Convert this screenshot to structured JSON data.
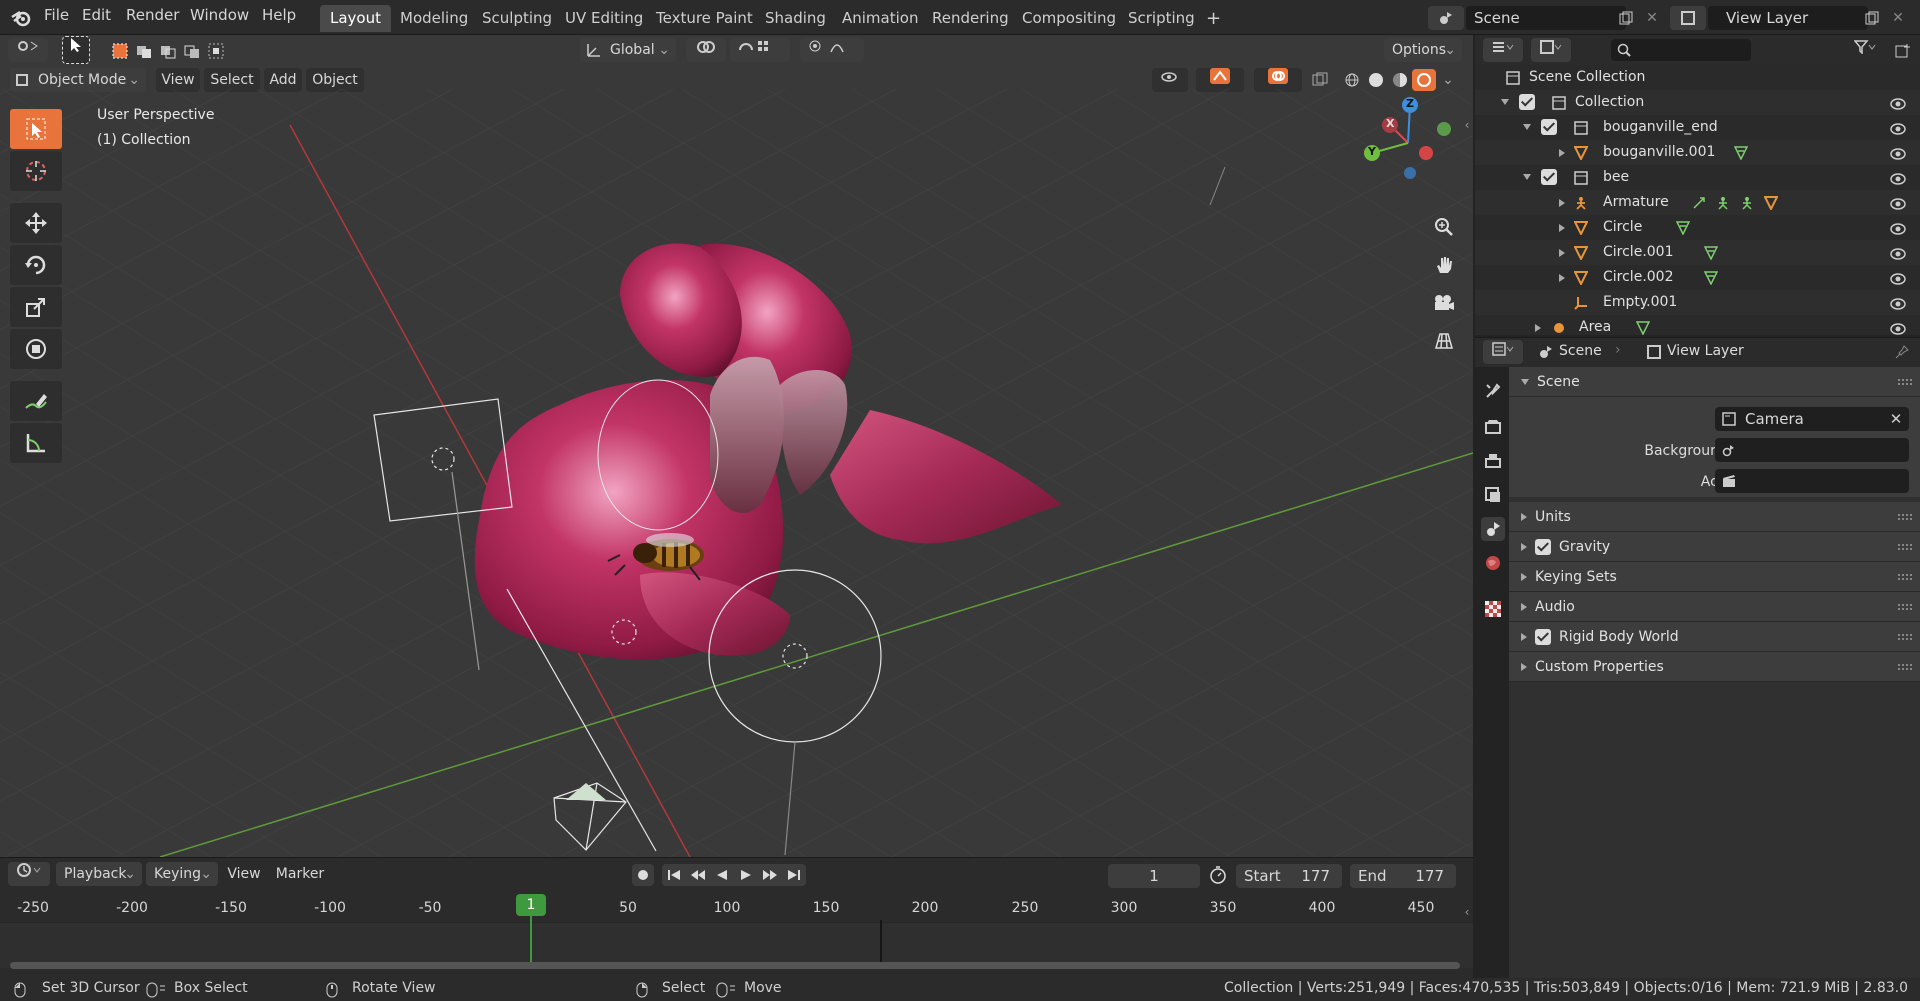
{
  "menus": [
    "File",
    "Edit",
    "Render",
    "Window",
    "Help"
  ],
  "workspaces": [
    "Layout",
    "Modeling",
    "Sculpting",
    "UV Editing",
    "Texture Paint",
    "Shading",
    "Animation",
    "Rendering",
    "Compositing",
    "Scripting"
  ],
  "scene_field": "Scene",
  "view_layer_field": "View Layer",
  "toolbar": {
    "orientation": "Global",
    "options": "Options"
  },
  "viewport": {
    "mode": "Object Mode",
    "menus": [
      "View",
      "Select",
      "Add",
      "Object"
    ],
    "overlay_title": "User Perspective",
    "overlay_collection": "(1) Collection",
    "gizmo": {
      "x": "X",
      "y": "Y",
      "z": "Z"
    }
  },
  "timeline": {
    "menus": [
      "Playback",
      "Keying",
      "View",
      "Marker"
    ],
    "current_frame": "1",
    "start_label": "Start",
    "start": "177",
    "end_label": "End",
    "end": "177",
    "ruler": [
      "-250",
      "-200",
      "-150",
      "-100",
      "-50",
      "1",
      "50",
      "100",
      "150",
      "200",
      "250",
      "300",
      "350",
      "400",
      "450"
    ],
    "playhead": "1"
  },
  "status": {
    "set_cursor": "Set 3D Cursor",
    "box_select": "Box Select",
    "rotate": "Rotate View",
    "select": "Select",
    "move": "Move",
    "stats": "Collection | Verts:251,949 | Faces:470,535 | Tris:503,849 | Objects:0/16 | Mem: 721.9 MiB | 2.83.0"
  },
  "outliner": {
    "rows": [
      {
        "label": "Scene Collection"
      },
      {
        "label": "Collection"
      },
      {
        "label": "bouganville_end"
      },
      {
        "label": "bouganville.001"
      },
      {
        "label": "bee"
      },
      {
        "label": "Armature"
      },
      {
        "label": "Circle"
      },
      {
        "label": "Circle.001"
      },
      {
        "label": "Circle.002"
      },
      {
        "label": "Empty.001"
      },
      {
        "label": "Area"
      }
    ]
  },
  "properties": {
    "crumb_scene": "Scene",
    "crumb_layer": "View Layer",
    "section_scene": "Scene",
    "camera_label": "Camera",
    "camera_value": "Camera",
    "bg_scene_label": "Background Scene",
    "active_clip_label": "Active Clip",
    "sections": [
      "Units",
      "Gravity",
      "Keying Sets",
      "Audio",
      "Rigid Body World",
      "Custom Properties"
    ]
  },
  "colors": {
    "accent": "#e8743b",
    "x_axis": "#e04a4f",
    "y_axis": "#6fbf3f",
    "z_axis": "#3d8fe0",
    "playhead": "#3f9a3f"
  }
}
